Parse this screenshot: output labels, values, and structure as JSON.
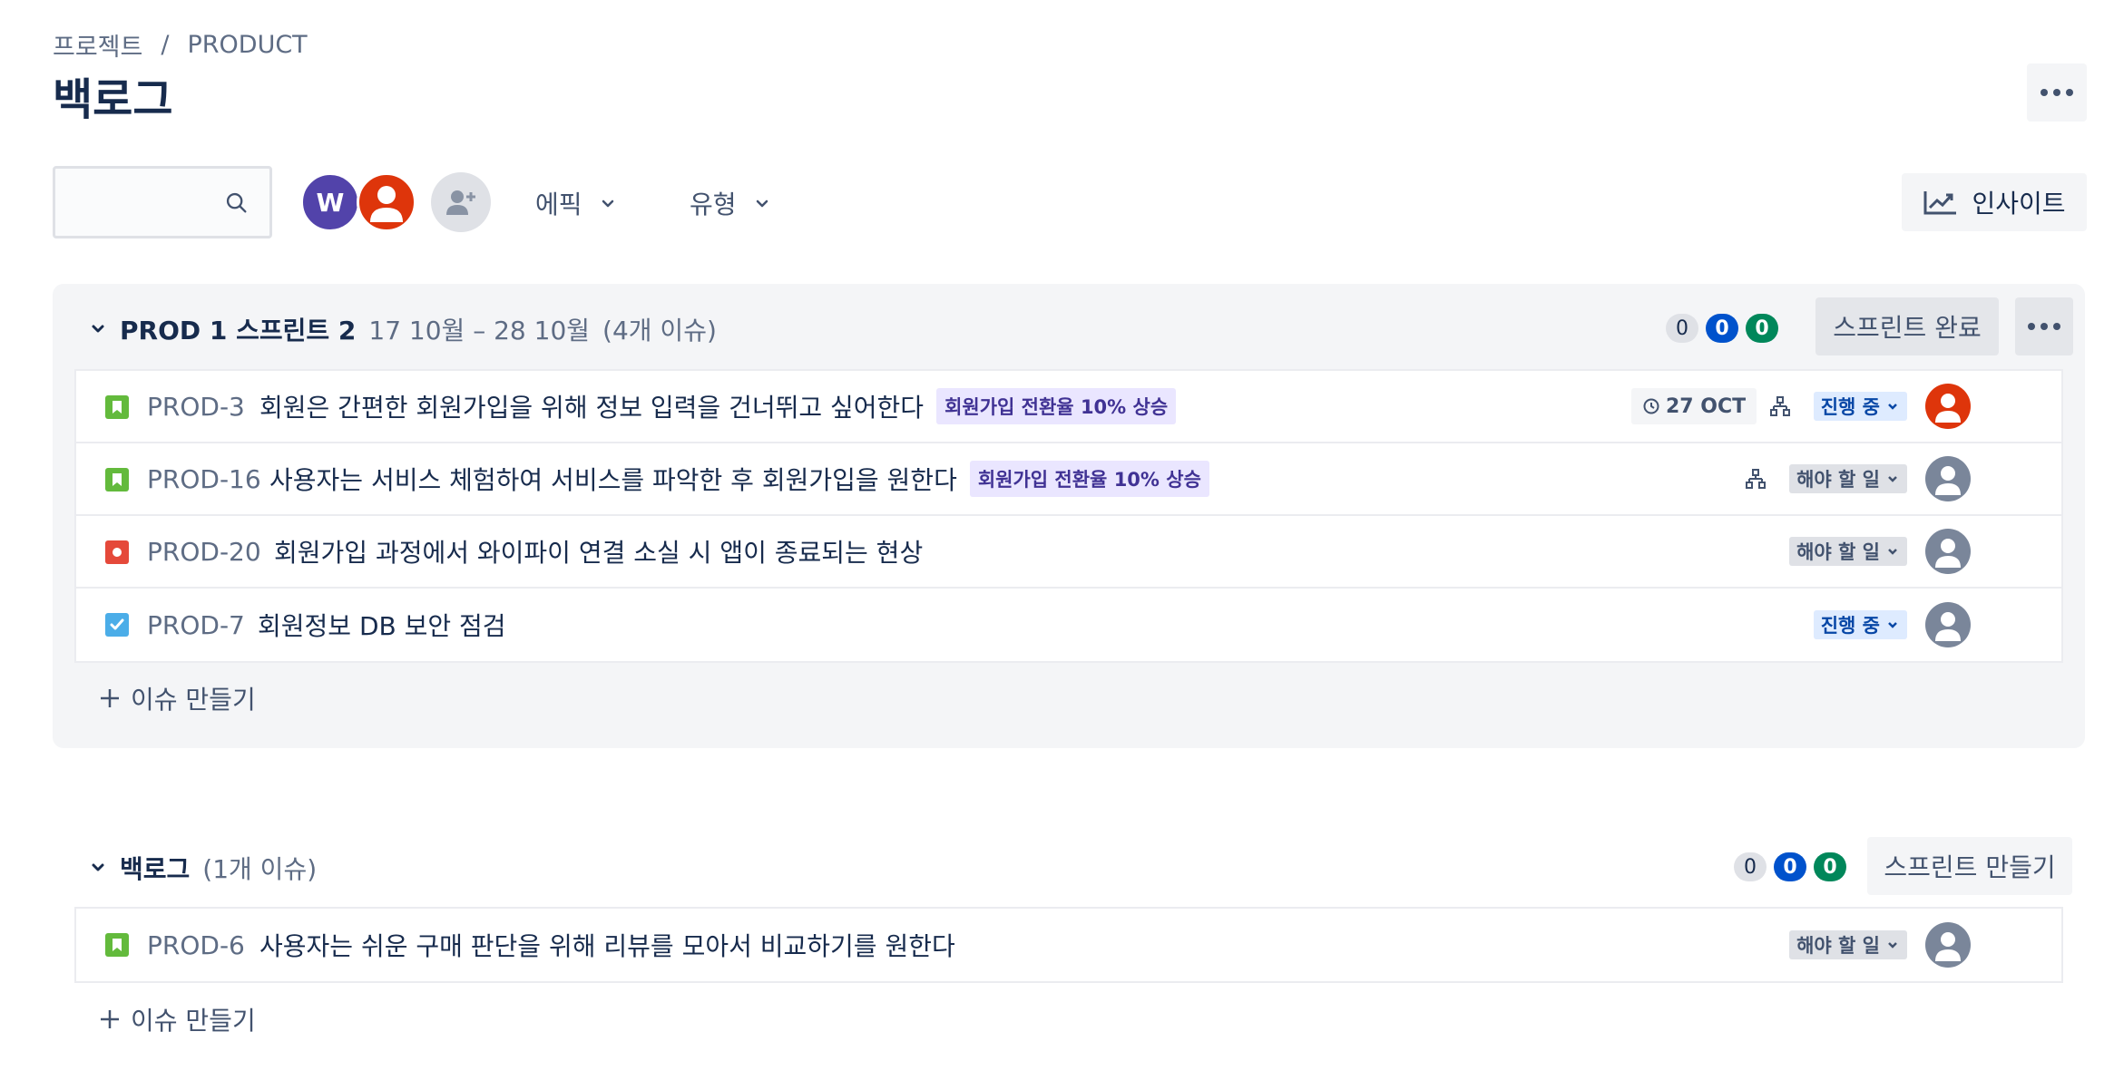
{
  "breadcrumb": {
    "root": "프로젝트",
    "separator": "/",
    "project": "PRODUCT"
  },
  "page_title": "백로그",
  "toolbar": {
    "search_placeholder": "",
    "avatar_w_initial": "W",
    "filter_epic": "에픽",
    "filter_type": "유형",
    "insight_label": "인사이트"
  },
  "sprint": {
    "name": "PROD 1 스프린트 2",
    "dates": "17 10월 – 28 10월",
    "issue_count": "(4개 이슈)",
    "counts": {
      "todo": "0",
      "in_progress": "0",
      "done": "0"
    },
    "complete_label": "스프린트 완료",
    "issues": [
      {
        "key": "PROD-3",
        "summary": "회원은 간편한 회원가입을 위해 정보 입력을 건너뛰고 싶어한다",
        "epic": "회원가입 전환율 10% 상승",
        "due": "27 OCT",
        "status": "진행 중",
        "type": "story"
      },
      {
        "key": "PROD-16",
        "summary": "사용자는 서비스 체험하여 서비스를 파악한 후 회원가입을 원한다",
        "epic": "회원가입 전환율 10% 상승",
        "status": "해야 할 일",
        "type": "story"
      },
      {
        "key": "PROD-20",
        "summary": "회원가입 과정에서 와이파이 연결 소실 시 앱이 종료되는 현상",
        "status": "해야 할 일",
        "type": "bug"
      },
      {
        "key": "PROD-7",
        "summary": "회원정보 DB 보안 점검",
        "status": "진행 중",
        "type": "task"
      }
    ],
    "create_issue": "이슈 만들기"
  },
  "backlog": {
    "name": "백로그",
    "issue_count": "(1개 이슈)",
    "counts": {
      "todo": "0",
      "in_progress": "0",
      "done": "0"
    },
    "create_sprint_label": "스프린트 만들기",
    "issues": [
      {
        "key": "PROD-6",
        "summary": "사용자는 쉬운 구매 판단을 위해 리뷰를 모아서 비교하기를 원한다",
        "status": "해야 할 일",
        "type": "story"
      }
    ],
    "create_issue": "이슈 만들기"
  }
}
